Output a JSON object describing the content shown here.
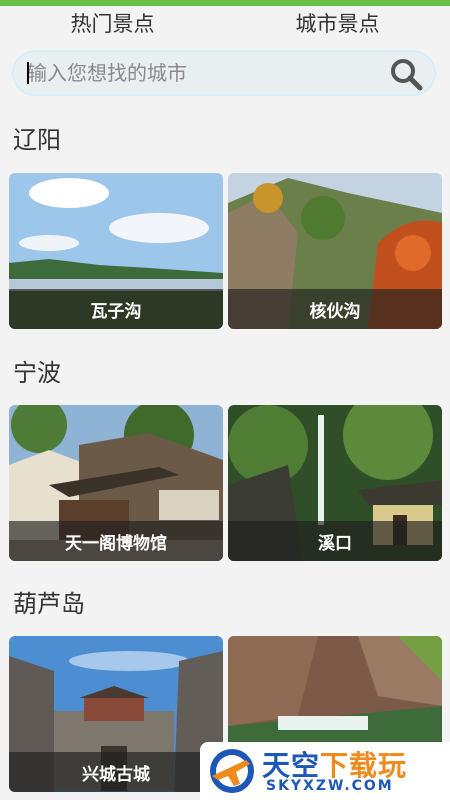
{
  "tabs": [
    {
      "label": "热门景点"
    },
    {
      "label": "城市景点"
    }
  ],
  "search": {
    "placeholder": "输入您想找的城市",
    "value": ""
  },
  "sections": [
    {
      "city": "辽阳",
      "spots": [
        {
          "name": "瓦子沟"
        },
        {
          "name": "核伙沟"
        }
      ]
    },
    {
      "city": "宁波",
      "spots": [
        {
          "name": "天一阁博物馆"
        },
        {
          "name": "溪口"
        }
      ]
    },
    {
      "city": "葫芦岛",
      "spots": [
        {
          "name": "兴城古城"
        },
        {
          "name": ""
        }
      ]
    }
  ],
  "watermark": {
    "title_a": "天空",
    "title_b": "下载玩",
    "sub": "SKYXZW.COM"
  },
  "colors": {
    "accent": "#6cc04a",
    "watermark_blue": "#1d57b8",
    "watermark_orange": "#f08a1c"
  }
}
